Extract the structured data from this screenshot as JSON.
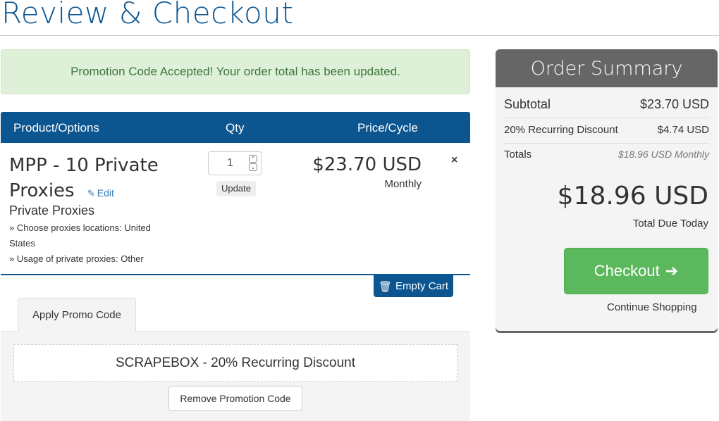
{
  "page": {
    "title": "Review & Checkout"
  },
  "alert": {
    "message": "Promotion Code Accepted! Your order total has been updated."
  },
  "cart": {
    "headers": {
      "product": "Product/Options",
      "qty": "Qty",
      "price": "Price/Cycle"
    },
    "item": {
      "name": "MPP - 10 Private Proxies",
      "edit_label": "Edit",
      "group": "Private Proxies",
      "options": [
        "» Choose proxies locations: United States",
        "» Usage of private proxies: Other"
      ],
      "quantity": "1",
      "update_label": "Update",
      "price": "$23.70 USD",
      "cycle": "Monthly",
      "remove_icon": "×"
    },
    "empty_cart_label": "Empty Cart"
  },
  "promo": {
    "tab_label": "Apply Promo Code",
    "applied_code": "SCRAPEBOX - 20% Recurring Discount",
    "remove_label": "Remove Promotion Code"
  },
  "summary": {
    "title": "Order Summary",
    "subtotal_label": "Subtotal",
    "subtotal_value": "$23.70 USD",
    "discount_label": "20% Recurring Discount",
    "discount_value": "$4.74 USD",
    "totals_label": "Totals",
    "totals_value": "$18.96 USD Monthly",
    "due_amount": "$18.96 USD",
    "due_label": "Total Due Today",
    "checkout_label": "Checkout",
    "continue_label": "Continue Shopping"
  },
  "colors": {
    "brand": "#0b5590",
    "success": "#5cb85c",
    "summary_header": "#666666",
    "alert_bg": "#dff0d8",
    "alert_text": "#3c763d"
  }
}
